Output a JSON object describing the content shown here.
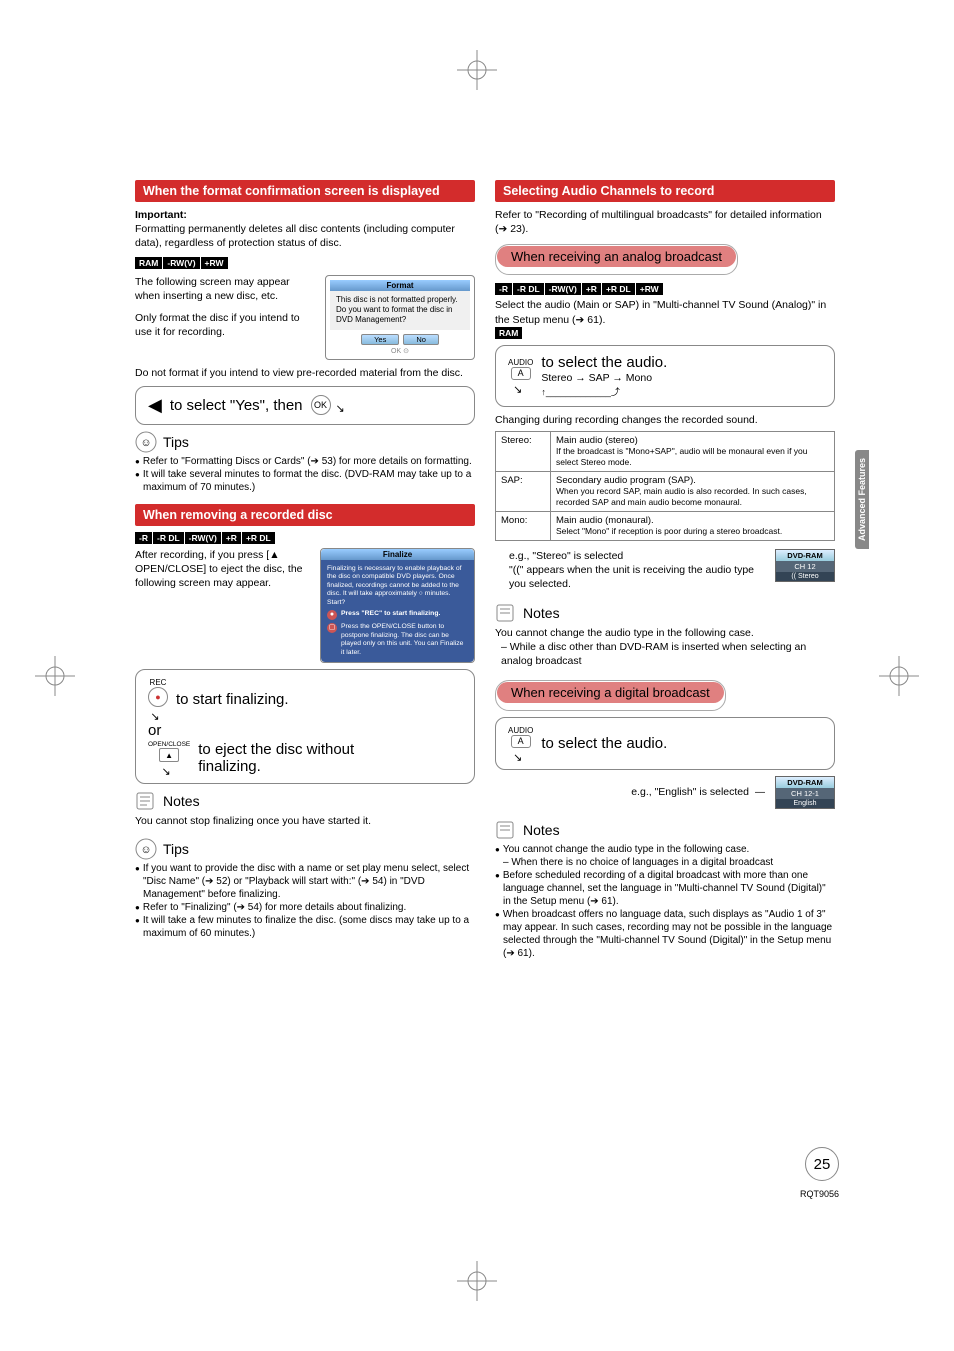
{
  "left": {
    "box1_title": "When the format confirmation screen is displayed",
    "important_label": "Important:",
    "important_text": "Formatting permanently deletes all disc contents (including computer data), regardless of protection status of disc.",
    "chips1": [
      "RAM",
      "-RW(V)",
      "+RW"
    ],
    "p1": "The following screen may appear when inserting a new disc, etc.",
    "p2": "Only format the disc if you intend to use it for recording.",
    "p3": "Do not format if you intend to view pre-recorded material from the disc.",
    "dialog": {
      "title": "Format",
      "body": "This disc is not formatted properly. Do you want to format the disc in DVD Management?",
      "yes": "Yes",
      "no": "No"
    },
    "action1": "to select \"Yes\", then",
    "tips_label": "Tips",
    "tips1": [
      "Refer to \"Formatting Discs or Cards\" (➔ 53) for more details on formatting.",
      "It will take several minutes to format the disc. (DVD-RAM may take up to a maximum of 70 minutes.)"
    ],
    "box2_title": "When removing a recorded disc",
    "chips2": [
      "-R",
      "-R DL",
      "-RW(V)",
      "+R",
      "+R DL"
    ],
    "p4": "After recording, if you press [▲ OPEN/CLOSE] to eject the disc, the following screen may appear.",
    "dialog2": {
      "title": "Finalize",
      "body": "Finalizing is necessary to enable playback of the disc on compatible DVD players. Once finalized, recordings cannot be added to the disc. It will take approximately ○ minutes. Start?",
      "row1": "Press \"REC\" to start finalizing.",
      "row2": "Press the OPEN/CLOSE button to postpone finalizing. The disc can be played only on this unit. You can Finalize it later."
    },
    "rec_label": "REC",
    "action2": "to start finalizing.",
    "or": "or",
    "oc_label": "OPEN/CLOSE",
    "action3a": "to eject the disc without",
    "action3b": "finalizing.",
    "notes_label": "Notes",
    "note1": "You cannot stop finalizing once you have started it.",
    "tips2": [
      "If you want to provide the disc with a name or set play menu select, select \"Disc Name\" (➔ 52) or \"Playback will start with:\" (➔ 54) in \"DVD Management\" before finalizing.",
      "Refer to \"Finalizing\" (➔ 54) for more details about finalizing.",
      "It will take a few minutes to finalize the disc. (some discs may take up to a maximum of 60 minutes.)"
    ]
  },
  "right": {
    "box3_title": "Selecting Audio Channels to record",
    "r1": "Refer to \"Recording of multilingual broadcasts\" for detailed information (➔ 23).",
    "pink1": "When receiving an analog broadcast",
    "chips3": [
      "-R",
      "-R DL",
      "-RW(V)",
      "+R",
      "+R DL",
      "+RW"
    ],
    "r2": "Select the audio (Main or SAP) in \"Multi-channel TV Sound (Analog)\" in the Setup menu (➔ 61).",
    "chips4": [
      "RAM"
    ],
    "audio_label": "AUDIO",
    "audio_btn": "A",
    "action4": "to select the audio.",
    "cycle": "Stereo → SAP → Mono",
    "r3": "Changing during recording changes the recorded sound.",
    "table": [
      {
        "k": "Stereo:",
        "v": "Main audio (stereo)",
        "s": "If the broadcast is \"Mono+SAP\", audio will be monaural even if you select Stereo mode."
      },
      {
        "k": "SAP:",
        "v": "Secondary audio program (SAP).",
        "s": "When you record SAP, main audio is also recorded. In such cases, recorded SAP and main audio become monaural."
      },
      {
        "k": "Mono:",
        "v": "Main audio (monaural).",
        "s": "Select \"Mono\" if reception is poor during a stereo broadcast."
      }
    ],
    "eg1a": "e.g., \"Stereo\" is selected",
    "eg1b": "\"((\" appears when the unit is receiving the audio type you selected.",
    "osd1": {
      "t": "DVD-RAM",
      "r1": "CH 12",
      "r2": "(( Stereo"
    },
    "note_a": "You cannot change the audio type in the following case.",
    "note_a_sub": "While a disc other than DVD-RAM is inserted when selecting an analog broadcast",
    "pink2": "When receiving a digital broadcast",
    "action5": "to select the audio.",
    "eg2": "e.g., \"English\" is selected",
    "osd2": {
      "t": "DVD-RAM",
      "r1": "CH 12-1",
      "r2": "English"
    },
    "notes2": [
      "You cannot change the audio type in the following case.",
      "Before scheduled recording of a digital broadcast with more than one language channel, set the language in \"Multi-channel TV Sound (Digital)\" in the Setup menu (➔ 61).",
      "When broadcast offers no language data, such displays as \"Audio 1 of 3\" may appear. In such cases, recording may not be possible in the language selected through the \"Multi-channel TV Sound (Digital)\" in the Setup menu (➔ 61)."
    ],
    "note2_sub": "When there is no choice of languages in a digital broadcast"
  },
  "side": "Advanced Features",
  "pagenum": "25",
  "doccode": "RQT9056"
}
